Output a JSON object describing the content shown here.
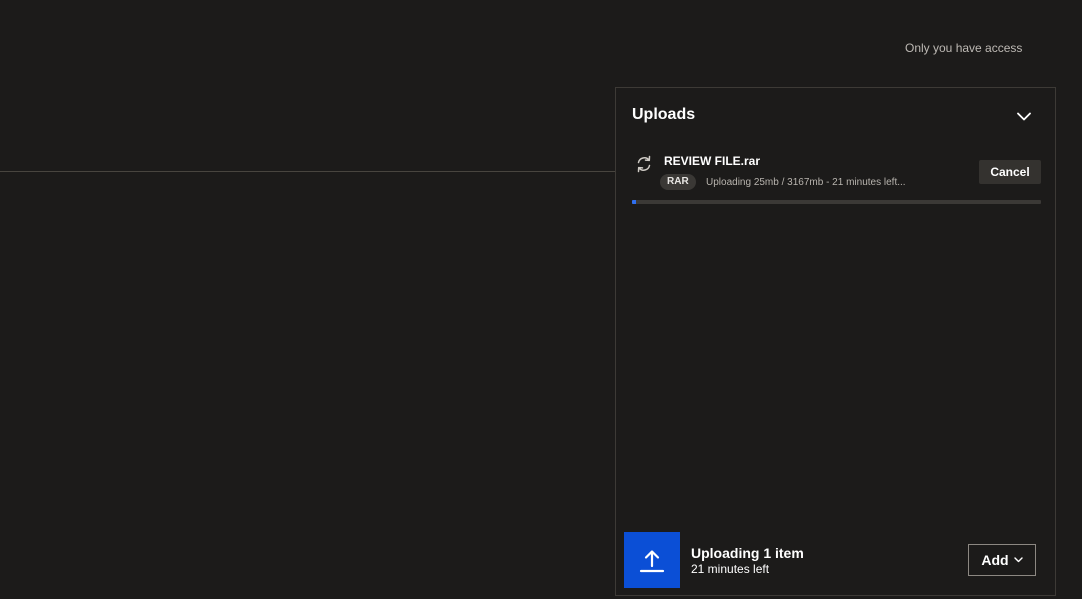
{
  "header": {
    "access_text": "Only you have access"
  },
  "uploads_panel": {
    "title": "Uploads",
    "items": [
      {
        "file_name": "REVIEW FILE.rar",
        "badge": "RAR",
        "status": "Uploading 25mb / 3167mb - 21 minutes left...",
        "cancel_label": "Cancel",
        "progress_percent": 1
      }
    ],
    "footer": {
      "title": "Uploading 1 item",
      "subtitle": "21 minutes left",
      "add_label": "Add"
    }
  },
  "colors": {
    "background": "#1c1b1a",
    "accent": "#0b4fd6",
    "progress": "#2f6ff0"
  },
  "icons": [
    "chevron-down-icon",
    "sync-icon",
    "upload-arrow-icon"
  ]
}
